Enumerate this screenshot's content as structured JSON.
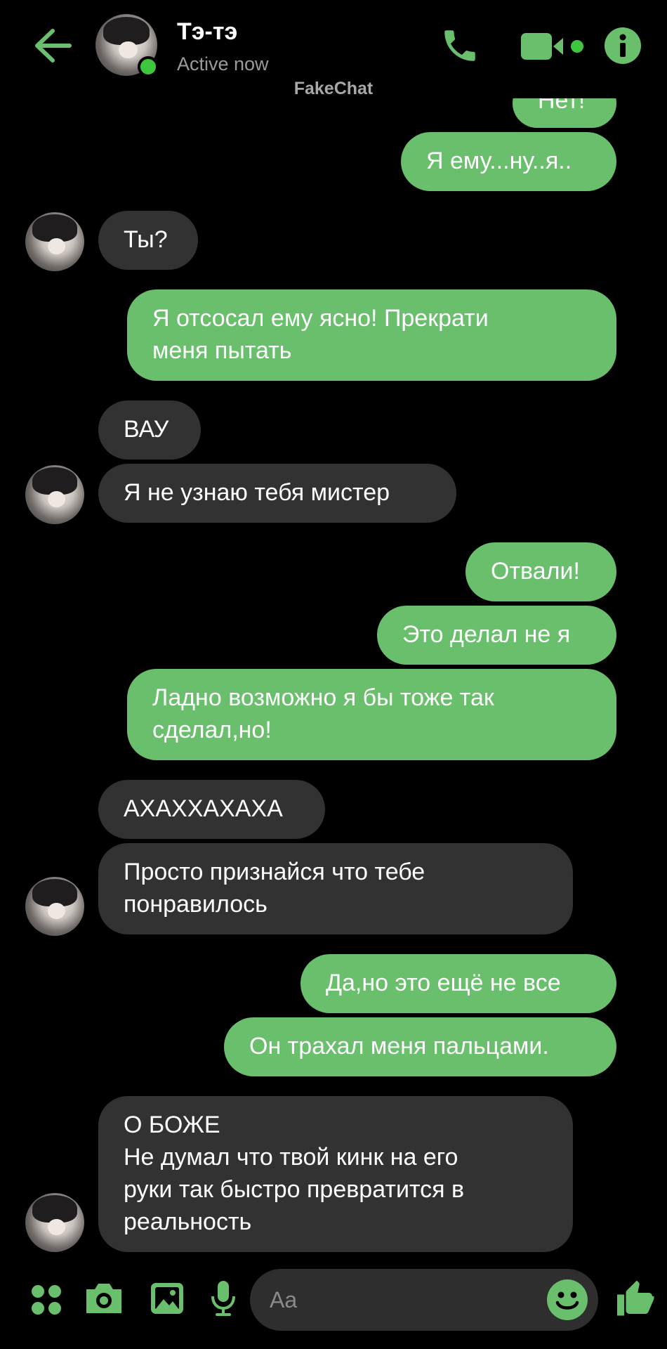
{
  "header": {
    "contact_name": "Тэ-тэ",
    "status": "Active now",
    "watermark": "FakeChat"
  },
  "messages": [
    {
      "from": "me",
      "text": "Нет!"
    },
    {
      "from": "me",
      "text": "Я ему...ну..я.."
    },
    {
      "from": "them",
      "text": "Ты?"
    },
    {
      "from": "me",
      "text": "Я отсосал ему ясно! Прекрати\nменя пытать"
    },
    {
      "from": "them",
      "text": "ВАУ"
    },
    {
      "from": "them",
      "text": "Я не узнаю тебя мистер"
    },
    {
      "from": "me",
      "text": "Отвали!"
    },
    {
      "from": "me",
      "text": "Это делал не я"
    },
    {
      "from": "me",
      "text": "Ладно возможно я бы тоже так\nсделал,но!"
    },
    {
      "from": "them",
      "text": "АХАХХАХАХА"
    },
    {
      "from": "them",
      "text": "Просто признайся что тебе\nпонравилось"
    },
    {
      "from": "me",
      "text": "Да,но это ещё не все"
    },
    {
      "from": "me",
      "text": "Он трахал меня пальцами."
    },
    {
      "from": "them",
      "text": "О БОЖЕ\nНе думал что твой кинк на его\nруки так быстро превратится в\nреальность"
    }
  ],
  "composer": {
    "placeholder": "Aa"
  },
  "colors": {
    "accent": "#6abf6d",
    "outgoing_bubble": "#6abf6d",
    "incoming_bubble": "#323232",
    "background": "#000000",
    "online_dot": "#3fc63f"
  },
  "icons": {
    "back": "arrow-left-icon",
    "call": "phone-icon",
    "video": "video-camera-icon",
    "info": "info-icon",
    "menu": "four-dots-icon",
    "camera": "camera-icon",
    "gallery": "image-icon",
    "mic": "microphone-icon",
    "emoji": "smiley-icon",
    "like": "thumbs-up-icon"
  }
}
